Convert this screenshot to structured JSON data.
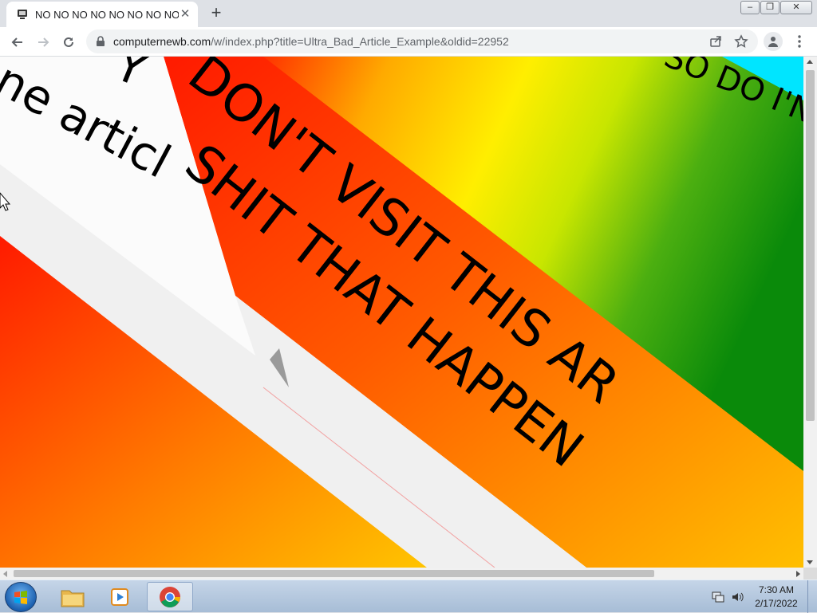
{
  "browser": {
    "tab": {
      "title": "NO NO NO NO NO NO NO NO",
      "close": "✕"
    },
    "new_tab": "+",
    "url_host": "computernewb.com",
    "url_path": "/w/index.php?title=Ultra_Bad_Article_Example&oldid=22952",
    "window_buttons": {
      "minimize": "‒",
      "maximize": "❐",
      "close": "✕"
    }
  },
  "page": {
    "text_white_band_1": "Y",
    "text_white_band_2": "ne articl",
    "text_red_band_1": "DON'T VISIT THIS AR",
    "text_red_band_2": "SHIT THAT HAPPEN",
    "text_top_right": "SO DO I'N"
  },
  "taskbar": {
    "clock_time": "7:30 AM",
    "clock_date": "2/17/2022"
  },
  "colors": {
    "red": "#ff1a00",
    "orange": "#ff8c00",
    "yellow": "#ffee00",
    "green": "#0a8a0a",
    "cyan": "#00e5ff",
    "white_band": "#f7f7f7"
  }
}
